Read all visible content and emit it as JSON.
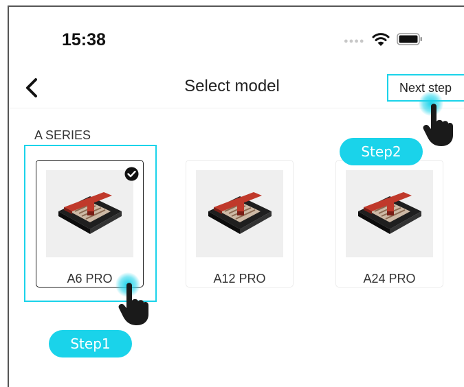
{
  "status_bar": {
    "time": "15:38",
    "icons": [
      "signal-dots-icon",
      "wifi-icon",
      "battery-icon"
    ]
  },
  "nav": {
    "back_icon": "chevron-left-icon",
    "title": "Select model",
    "next_label": "Next step"
  },
  "series": {
    "label": "A SERIES",
    "models": [
      {
        "name": "A6 PRO",
        "selected": true
      },
      {
        "name": "A12 PRO",
        "selected": false
      },
      {
        "name": "A24 PRO",
        "selected": false
      }
    ]
  },
  "annotations": {
    "step1": "Step1",
    "step2": "Step2"
  },
  "colors": {
    "accent": "#1ad3ea",
    "text": "#222222",
    "card_bg": "#efefef",
    "printer_red": "#c0392b"
  }
}
